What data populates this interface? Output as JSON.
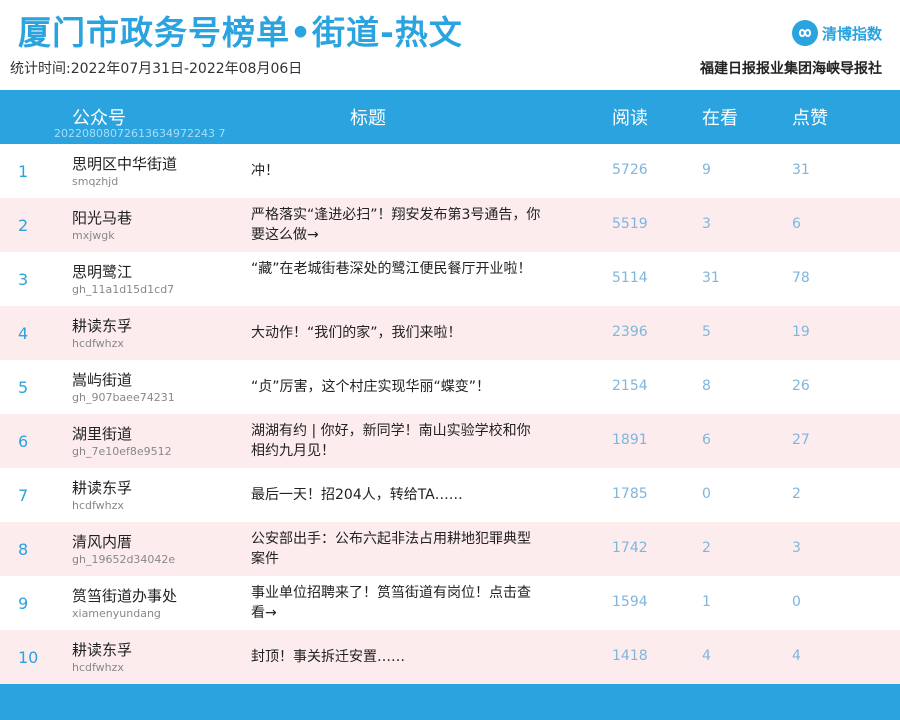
{
  "header": {
    "title": "厦门市政务号榜单•街道-热文",
    "period": "统计时间:2022年07月31日-2022年08月06日",
    "brand": "清博指数",
    "publisher": "福建日报报业集团海峡导报社"
  },
  "columns": {
    "account": "公众号",
    "article": "标题",
    "reads": "阅读",
    "looking": "在看",
    "likes": "点赞",
    "code": "20220808072613634972243 7"
  },
  "rows": [
    {
      "rank": "1",
      "name": "思明区中华街道",
      "account": "smqzhjd",
      "title": "冲！",
      "reads": "5726",
      "looking": "9",
      "likes": "31"
    },
    {
      "rank": "2",
      "name": "阳光马巷",
      "account": "mxjwgk",
      "title": "严格落实“逢进必扫”！翔安发布第3号通告，你要这么做→",
      "reads": "5519",
      "looking": "3",
      "likes": "6"
    },
    {
      "rank": "3",
      "name": "思明鹭江",
      "account": "gh_11a1d15d1cd7",
      "title": "“藏”在老城街巷深处的鹭江便民餐厅开业啦！",
      "reads": "5114",
      "looking": "31",
      "likes": "78"
    },
    {
      "rank": "4",
      "name": "耕读东孚",
      "account": "hcdfwhzx",
      "title": "大动作！“我们的家”，我们来啦！",
      "reads": "2396",
      "looking": "5",
      "likes": "19"
    },
    {
      "rank": "5",
      "name": "嵩屿街道",
      "account": "gh_907baee74231",
      "title": "“贞”厉害，这个村庄实现华丽“蝶变”！",
      "reads": "2154",
      "looking": "8",
      "likes": "26"
    },
    {
      "rank": "6",
      "name": "湖里街道",
      "account": "gh_7e10ef8e9512",
      "title": "湖湖有约 | 你好，新同学！南山实验学校和你相约九月见！",
      "reads": "1891",
      "looking": "6",
      "likes": "27"
    },
    {
      "rank": "7",
      "name": "耕读东孚",
      "account": "hcdfwhzx",
      "title": "最后一天！招204人，转给TA……",
      "reads": "1785",
      "looking": "0",
      "likes": "2"
    },
    {
      "rank": "8",
      "name": "清风内厝",
      "account": "gh_19652d34042e",
      "title": "公安部出手：公布六起非法占用耕地犯罪典型案件",
      "reads": "1742",
      "looking": "2",
      "likes": "3"
    },
    {
      "rank": "9",
      "name": "筼筜街道办事处",
      "account": "xiamenyundang",
      "title": "事业单位招聘来了！筼筜街道有岗位！点击查看→",
      "reads": "1594",
      "looking": "1",
      "likes": "0"
    },
    {
      "rank": "10",
      "name": "耕读东孚",
      "account": "hcdfwhzx",
      "title": "封顶！事关拆迁安置……",
      "reads": "1418",
      "looking": "4",
      "likes": "4"
    }
  ],
  "colors": {
    "accent": "#2aa3df",
    "alt_row": "#fcecee",
    "number": "#7fb6dc"
  },
  "icons": {
    "brand": "infinity-logo-icon"
  }
}
